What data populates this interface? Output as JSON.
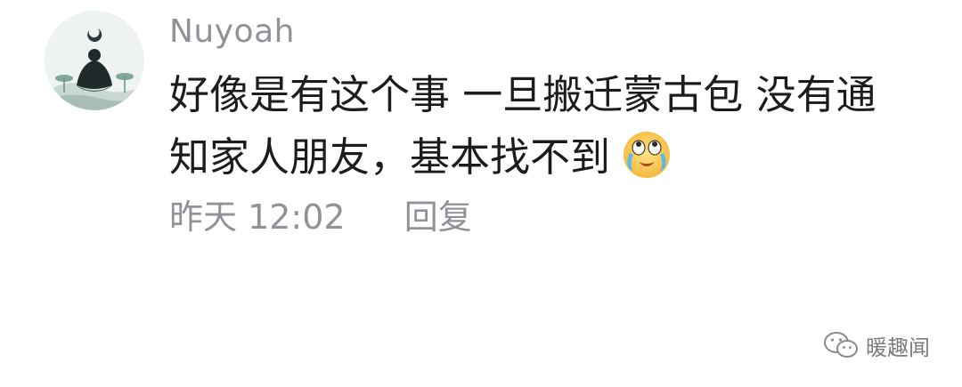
{
  "comment": {
    "username": "Nuyoah",
    "content_lines": [
      "好像是有这个事 一旦搬迁蒙古包 没有通",
      "知家人朋友，基本找不到"
    ],
    "emoji": "crying-laughing-emoji",
    "time": "昨天 12:02",
    "reply_label": "回复"
  },
  "watermark": {
    "text": "暖趣闻",
    "icon": "wechat-icon"
  },
  "colors": {
    "meta_gray": "#8f9399",
    "text_dark": "#1c1c1c"
  }
}
